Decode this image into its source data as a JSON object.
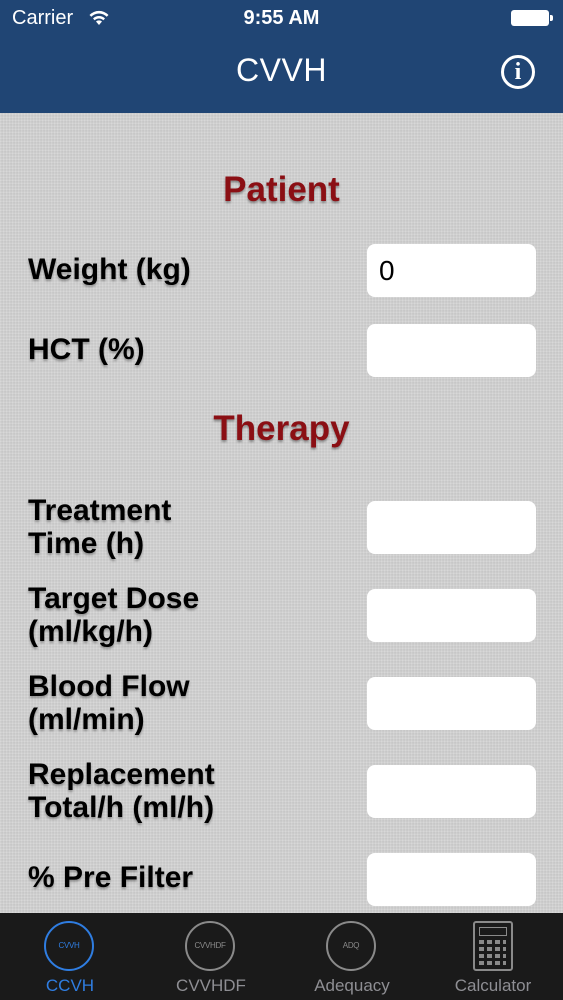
{
  "status_bar": {
    "carrier": "Carrier",
    "time": "9:55 AM"
  },
  "nav": {
    "title": "CVVH",
    "info_icon": "info-icon"
  },
  "sections": {
    "patient": "Patient",
    "therapy": "Therapy"
  },
  "fields": {
    "weight": {
      "label": "Weight (kg)",
      "value": "0"
    },
    "hct": {
      "label": "HCT (%)",
      "value": ""
    },
    "treatment_time": {
      "label_line1": "Treatment",
      "label_line2": "Time (h)",
      "value": ""
    },
    "target_dose": {
      "label_line1": "Target Dose",
      "label_line2": "(ml/kg/h)",
      "value": ""
    },
    "blood_flow": {
      "label_line1": "Blood Flow",
      "label_line2": "(ml/min)",
      "value": ""
    },
    "replacement_total": {
      "label_line1": "Replacement",
      "label_line2": "Total/h (ml/h)",
      "value": ""
    },
    "pre_filter": {
      "label": "% Pre Filter",
      "value": ""
    }
  },
  "tabs": [
    {
      "label": "CCVH",
      "icon_text": "CVVH",
      "active": true
    },
    {
      "label": "CVVHDF",
      "icon_text": "CVVHDF",
      "active": false
    },
    {
      "label": "Adequacy",
      "icon_text": "ADQ",
      "active": false
    },
    {
      "label": "Calculator",
      "icon_text": "",
      "active": false
    }
  ],
  "colors": {
    "nav_background": "#204574",
    "section_heading": "#8b0f14",
    "tab_active": "#2f7de1",
    "tab_inactive": "#8e8e93"
  }
}
